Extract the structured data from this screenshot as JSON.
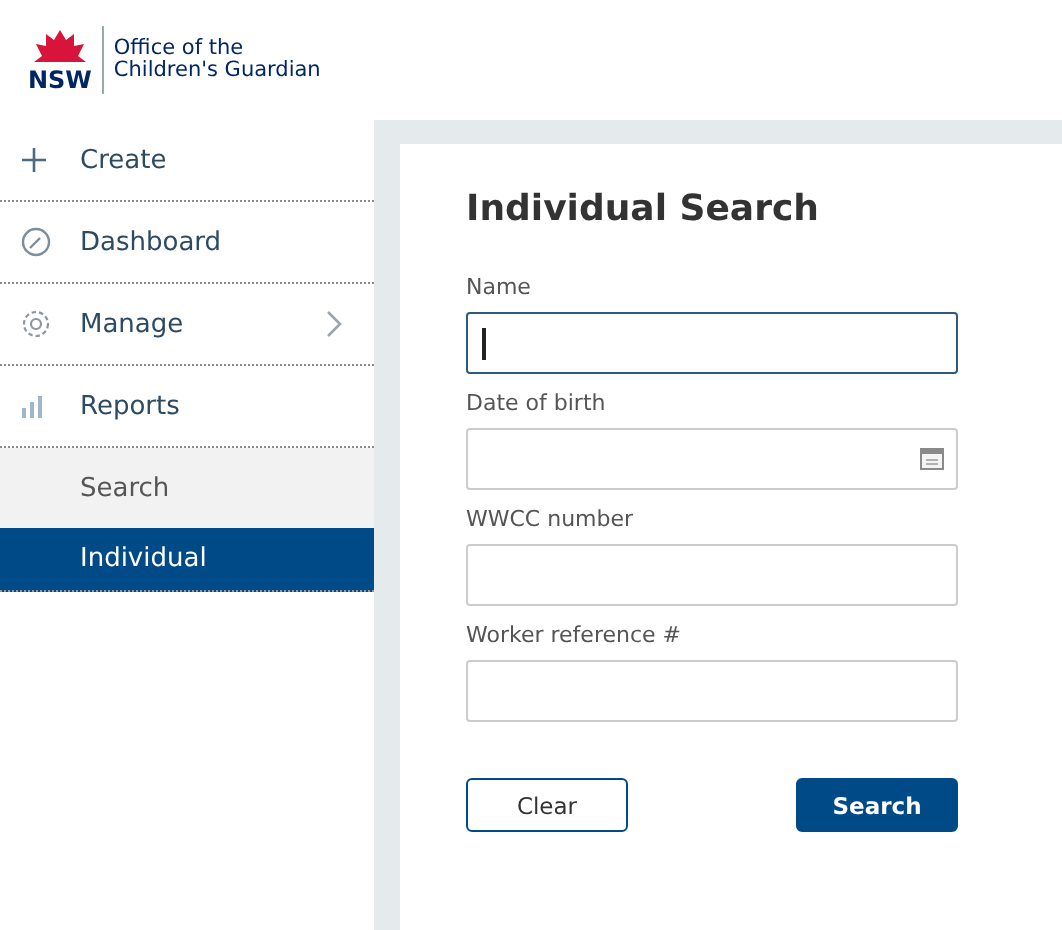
{
  "logo": {
    "mark": "NSW",
    "org_line_1": "Office of the",
    "org_line_2": "Children's Guardian"
  },
  "sidebar": {
    "items": [
      {
        "label": "Create"
      },
      {
        "label": "Dashboard"
      },
      {
        "label": "Manage",
        "expanded": false
      },
      {
        "label": "Reports",
        "expanded": true,
        "children": [
          {
            "label": "Search",
            "selected": false
          },
          {
            "label": "Individual",
            "selected": true
          }
        ]
      }
    ]
  },
  "form": {
    "title": "Individual Search",
    "fields": [
      {
        "label": "Name",
        "kind": "text",
        "focused": true
      },
      {
        "label": "Date of birth",
        "kind": "date",
        "focused": false
      },
      {
        "label": "WWCC number",
        "kind": "text",
        "focused": false
      },
      {
        "label": "Worker reference #",
        "kind": "text",
        "focused": false
      }
    ],
    "buttons": [
      {
        "label": "Clear",
        "kind": "secondary"
      },
      {
        "label": "Search",
        "kind": "primary"
      }
    ]
  }
}
